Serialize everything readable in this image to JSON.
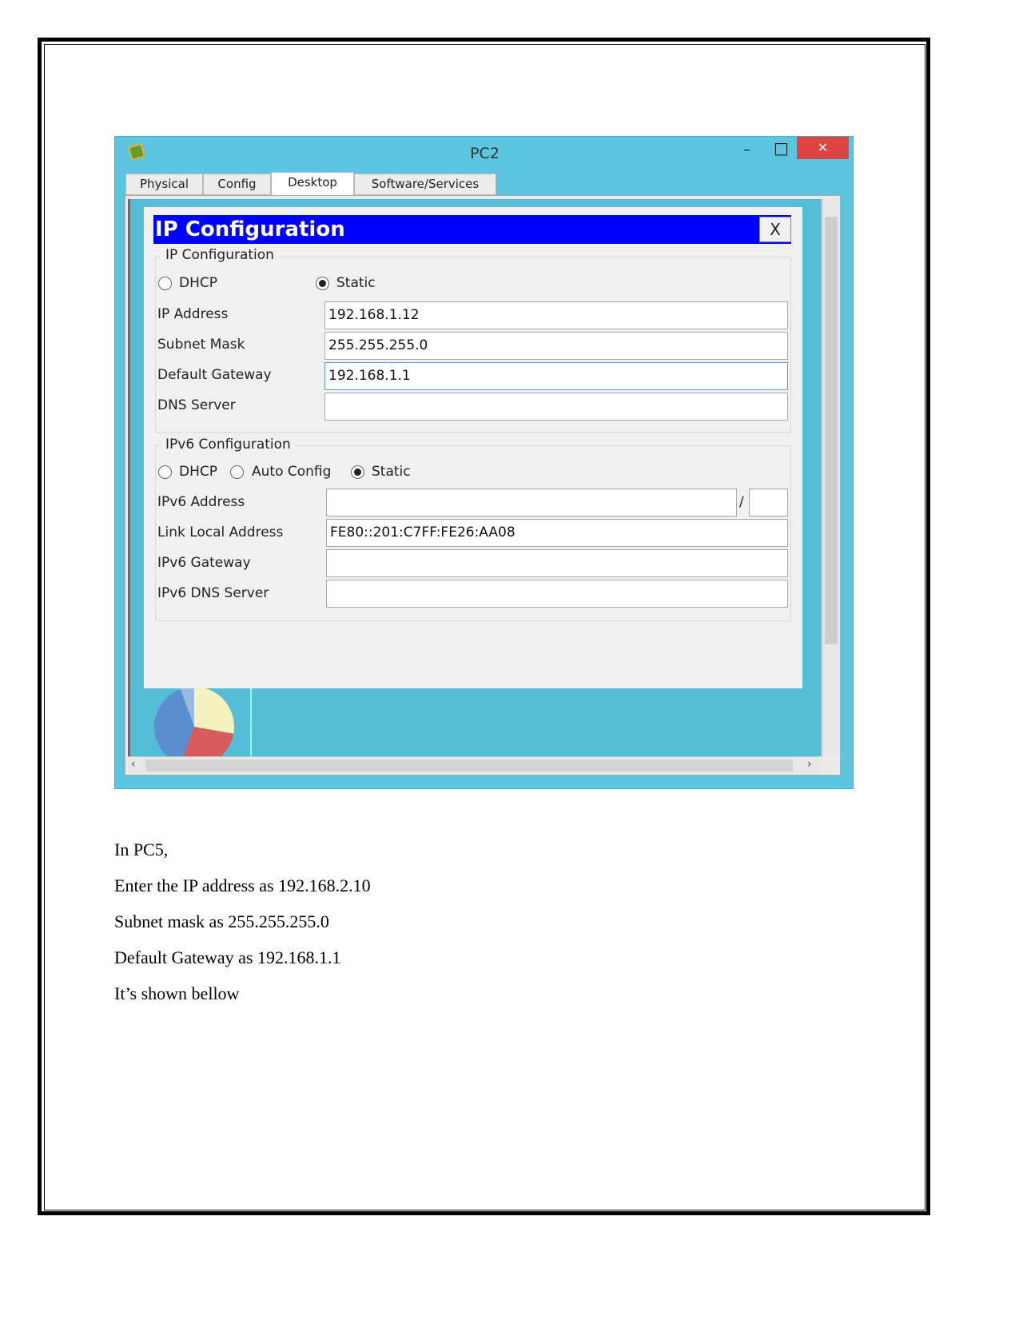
{
  "window": {
    "title": "PC2",
    "minimize": "–",
    "maximize": "□",
    "close": "✕"
  },
  "tabs": [
    {
      "label": "Physical"
    },
    {
      "label": "Config"
    },
    {
      "label": "Desktop",
      "active": true
    },
    {
      "label": "Software/Services"
    }
  ],
  "dialog": {
    "title": "IP Configuration",
    "close": "X",
    "ipv4": {
      "legend": "IP Configuration",
      "dhcp": "DHCP",
      "static": "Static",
      "selected": "Static",
      "ip_label": "IP Address",
      "ip": "192.168.1.12",
      "mask_label": "Subnet Mask",
      "mask": "255.255.255.0",
      "gw_label": "Default Gateway",
      "gw": "192.168.1.1",
      "dns_label": "DNS Server",
      "dns": ""
    },
    "ipv6": {
      "legend": "IPv6 Configuration",
      "dhcp": "DHCP",
      "auto": "Auto Config",
      "static": "Static",
      "selected": "Static",
      "addr_label": "IPv6 Address",
      "addr": "",
      "slash": "/",
      "prefix": "",
      "link_label": "Link Local Address",
      "link": "FE80::201:C7FF:FE26:AA08",
      "gw_label": "IPv6 Gateway",
      "gw": "",
      "dns_label": "IPv6 DNS Server",
      "dns": ""
    }
  },
  "colors": {
    "titlebar": "#5cc6e0",
    "close": "#e04343",
    "header": "#0000ff"
  },
  "doc": {
    "lines": [
      "In PC5,",
      "Enter the IP address as 192.168.2.10",
      "Subnet mask as 255.255.255.0",
      "Default Gateway as 192.168.1.1",
      "It’s shown bellow"
    ]
  }
}
